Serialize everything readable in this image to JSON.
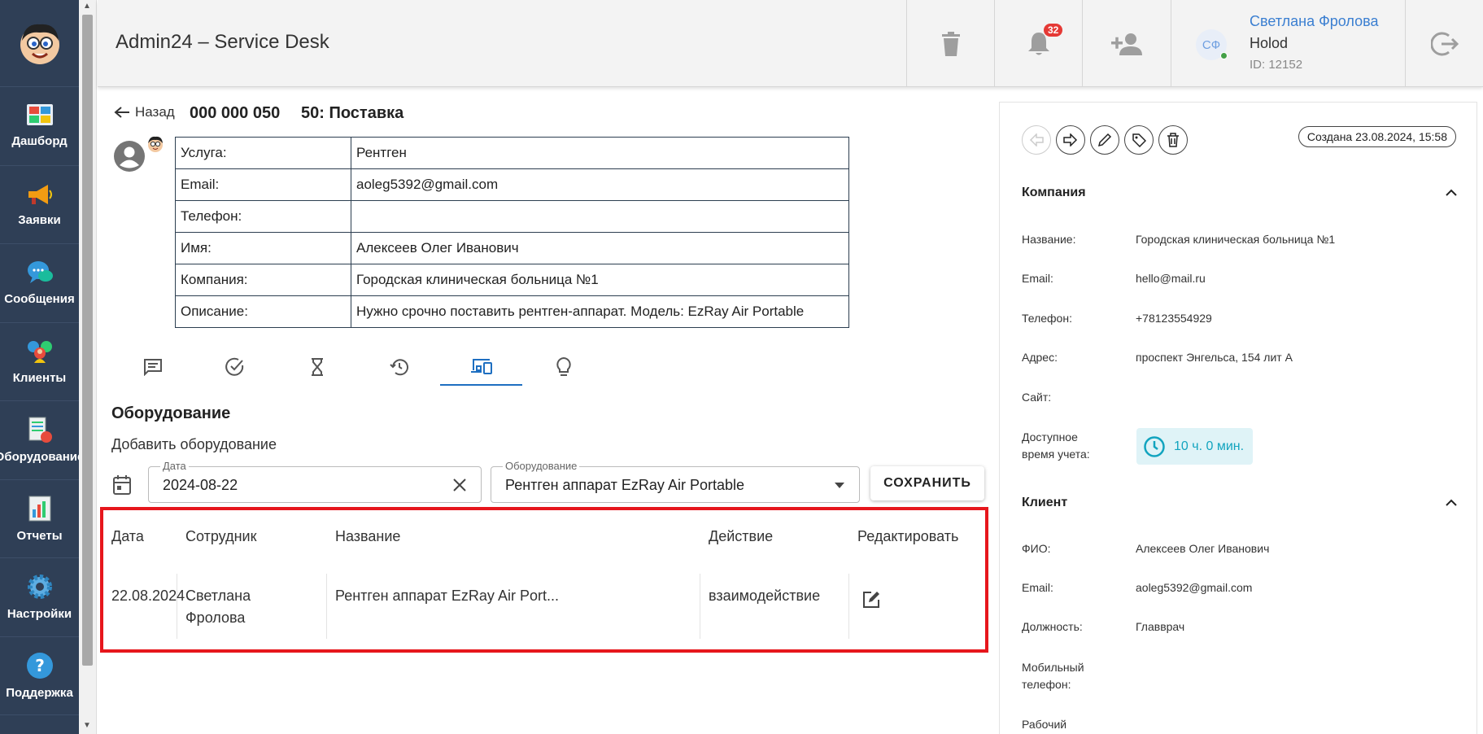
{
  "app": {
    "title": "Admin24 – Service Desk"
  },
  "sidebar": {
    "items": [
      {
        "label": "Дашборд",
        "icon": "dashboard-icon"
      },
      {
        "label": "Заявки",
        "icon": "megaphone-icon"
      },
      {
        "label": "Сообщения",
        "icon": "chat-icon"
      },
      {
        "label": "Клиенты",
        "icon": "clients-icon"
      },
      {
        "label": "Оборудование",
        "icon": "equipment-icon"
      },
      {
        "label": "Отчеты",
        "icon": "reports-icon"
      },
      {
        "label": "Настройки",
        "icon": "gear-icon"
      },
      {
        "label": "Поддержка",
        "icon": "help-icon"
      }
    ]
  },
  "header": {
    "notifications_count": "32",
    "user": {
      "initials": "СФ",
      "name": "Светлана Фролова",
      "org": "Holod",
      "id": "ID: 12152"
    }
  },
  "ticket": {
    "back_label": "Назад",
    "number": "000 000 050",
    "name": "50: Поставка",
    "info": [
      {
        "key": "Услуга:",
        "value": "Рентген"
      },
      {
        "key": "Email:",
        "value": "aoleg5392@gmail.com"
      },
      {
        "key": "Телефон:",
        "value": ""
      },
      {
        "key": "Имя:",
        "value": "Алексеев Олег Иванович"
      },
      {
        "key": "Компания:",
        "value": "Городская клиническая больница №1"
      },
      {
        "key": "Описание:",
        "value": "Нужно срочно поставить рентген-аппарат. Модель: EzRay Air Portable"
      }
    ]
  },
  "tabs": [
    "comments-icon",
    "check-circle-icon",
    "hourglass-icon",
    "history-icon",
    "devices-icon",
    "lightbulb-icon"
  ],
  "equipment": {
    "title": "Оборудование",
    "add_label": "Добавить оборудование",
    "date_field": {
      "label": "Дата",
      "value": "2024-08-22"
    },
    "equipment_field": {
      "label": "Оборудование",
      "value": "Рентген аппарат EzRay Air Portable"
    },
    "save_label": "СОХРАНИТЬ",
    "columns": [
      "Дата",
      "Сотрудник",
      "Название",
      "Действие",
      "Редактировать"
    ],
    "rows": [
      {
        "date": "22.08.2024",
        "employee_first": "Светлана",
        "employee_last": "Фролова",
        "name": "Рентген аппарат EzRay Air Port...",
        "action": "взаимодействие"
      }
    ]
  },
  "right_panel": {
    "created": "Создана 23.08.2024, 15:58",
    "company": {
      "title": "Компания",
      "fields": [
        {
          "key": "Название:",
          "value": "Городская клиническая больница №1"
        },
        {
          "key": "Email:",
          "value": "hello@mail.ru"
        },
        {
          "key": "Телефон:",
          "value": "+78123554929"
        },
        {
          "key": "Адрес:",
          "value": "проспект Энгельса, 154 лит А"
        },
        {
          "key": "Сайт:",
          "value": ""
        }
      ],
      "time_key_1": "Доступное",
      "time_key_2": "время учета:",
      "time_value": "10 ч. 0 мин."
    },
    "client": {
      "title": "Клиент",
      "fields": [
        {
          "key": "ФИО:",
          "value": "Алексеев Олег Иванович"
        },
        {
          "key": "Email:",
          "value": "aoleg5392@gmail.com"
        },
        {
          "key": "Должность:",
          "value": "Главврач"
        }
      ],
      "mobile_key_1": "Мобильный",
      "mobile_key_2": "телефон:",
      "work_key": "Рабочий"
    }
  },
  "colors": {
    "sidebar": "#2f3f56",
    "accent": "#1e6fc1",
    "highlight": "#e6161c",
    "link": "#3b7fd1"
  }
}
